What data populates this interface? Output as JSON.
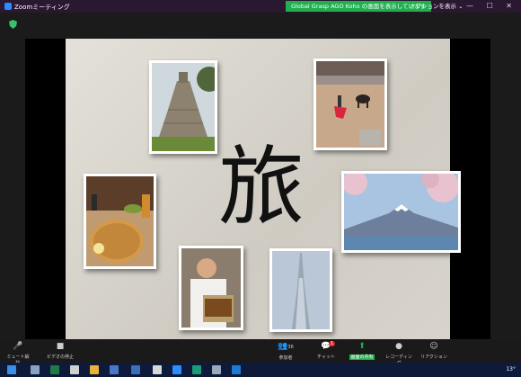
{
  "window": {
    "title": "Zoomミーティング",
    "controls": "— ☐ ✕"
  },
  "banner": {
    "text": "Global Grasp AGO Koho の画面を表示しています"
  },
  "view_options": {
    "label": "オプションを表示 ⌄"
  },
  "slide": {
    "kanji": "旅"
  },
  "toolbar": {
    "mute": "ミュート解除",
    "video": "ビデオの停止",
    "participants": "参加者",
    "participants_count": "36",
    "chat": "チャット",
    "chat_badge": "1",
    "share": "画面の共有",
    "record": "レコーディング",
    "reactions": "リアクション"
  },
  "taskbar": {
    "time": "13°"
  },
  "colors": {
    "banner": "#1fb04d",
    "share_icon": "#1fb04d",
    "chat_badge": "#e02b2b",
    "taskbar": "#0e1a3a"
  }
}
